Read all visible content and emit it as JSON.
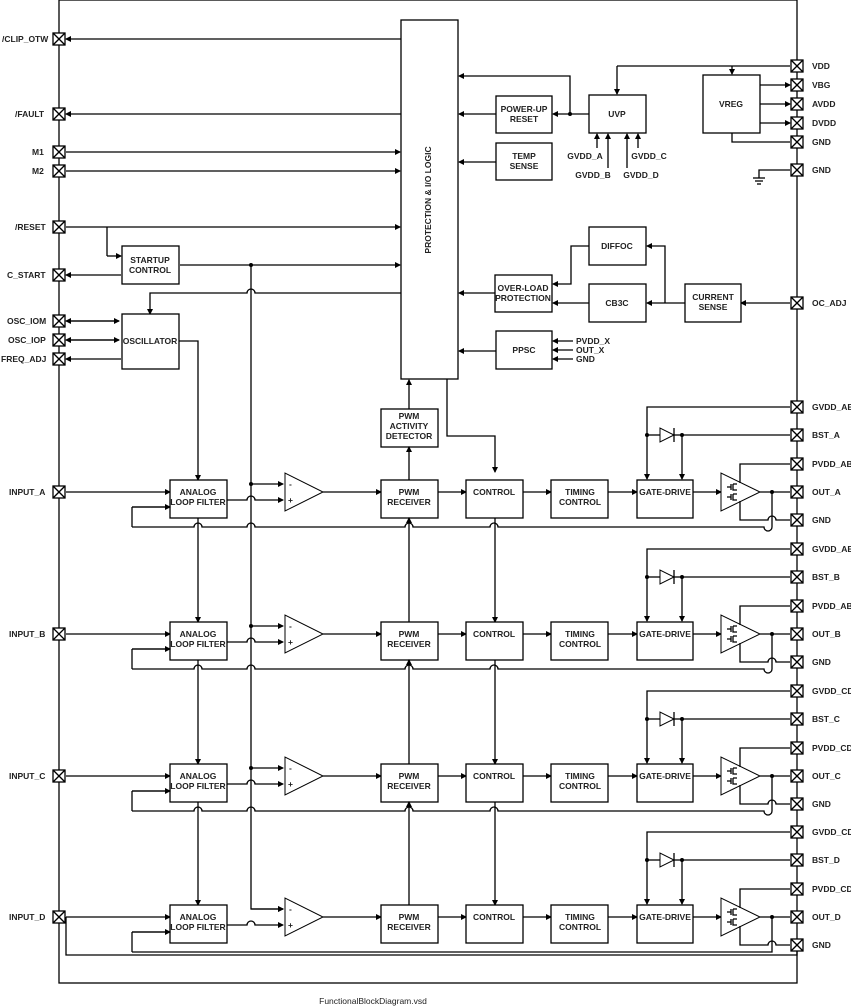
{
  "caption": "FunctionalBlockDiagram.vsd",
  "left_pins": {
    "clip_otw": "/CLIP_OTW",
    "fault": "/FAULT",
    "m1": "M1",
    "m2": "M2",
    "reset": "/RESET",
    "c_start": "C_START",
    "osc_iom": "OSC_IOM",
    "osc_iop": "OSC_IOP",
    "freq_adj": "FREQ_ADJ",
    "input_a": "INPUT_A",
    "input_b": "INPUT_B",
    "input_c": "INPUT_C",
    "input_d": "INPUT_D"
  },
  "right_pins": {
    "vdd": "VDD",
    "vbg": "VBG",
    "avdd": "AVDD",
    "dvdd": "DVDD",
    "gnd1": "GND",
    "gnd2": "GND",
    "oc_adj": "OC_ADJ"
  },
  "blocks": {
    "protection": "PROTECTION & I/O LOGIC",
    "powerup": [
      "POWER-UP",
      "RESET"
    ],
    "temp": [
      "TEMP",
      "SENSE"
    ],
    "uvp": "UVP",
    "vreg": "VREG",
    "startup": [
      "STARTUP",
      "CONTROL"
    ],
    "oscillator": "OSCILLATOR",
    "diffoc": "DIFFOC",
    "overload": [
      "OVER-LOAD",
      "PROTECTION"
    ],
    "cb3c": "CB3C",
    "current": [
      "CURRENT",
      "SENSE"
    ],
    "ppsc": "PPSC",
    "pwm_activity": [
      "PWM",
      "ACTIVITY",
      "DETECTOR"
    ]
  },
  "uvp_inputs": {
    "a": "GVDD_A",
    "b": "GVDD_B",
    "c": "GVDD_C",
    "d": "GVDD_D"
  },
  "ppsc_inputs": {
    "pvdd": "PVDD_X",
    "out": "OUT_X",
    "gnd": "GND"
  },
  "channels": [
    {
      "input": "INPUT_A",
      "gvdd": "GVDD_AB",
      "bst": "BST_A",
      "pvdd": "PVDD_AB",
      "out": "OUT_A",
      "gnd": "GND"
    },
    {
      "input": "INPUT_B",
      "gvdd": "GVDD_AB",
      "bst": "BST_B",
      "pvdd": "PVDD_AB",
      "out": "OUT_B",
      "gnd": "GND"
    },
    {
      "input": "INPUT_C",
      "gvdd": "GVDD_CD",
      "bst": "BST_C",
      "pvdd": "PVDD_CD",
      "out": "OUT_C",
      "gnd": "GND"
    },
    {
      "input": "INPUT_D",
      "gvdd": "GVDD_CD",
      "bst": "BST_D",
      "pvdd": "PVDD_CD",
      "out": "OUT_D",
      "gnd": "GND"
    }
  ],
  "channel_blocks": {
    "alf": [
      "ANALOG",
      "LOOP FILTER"
    ],
    "pwm_rx": [
      "PWM",
      "RECEIVER"
    ],
    "control": "CONTROL",
    "timing": [
      "TIMING",
      "CONTROL"
    ],
    "gate": "GATE-DRIVE",
    "minus": "-",
    "plus": "+"
  }
}
